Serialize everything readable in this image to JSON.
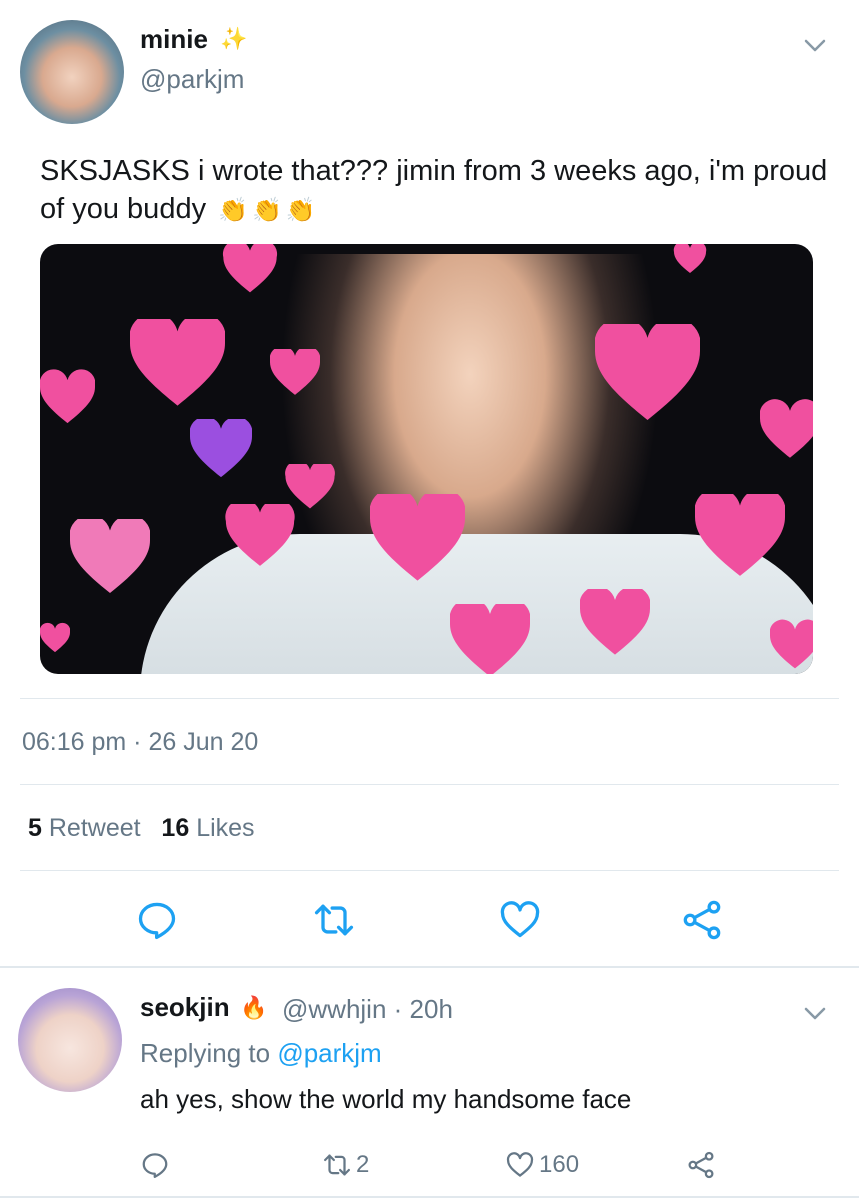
{
  "tweet": {
    "author_name": "minie",
    "author_badge": "✨",
    "author_handle": "@parkjm",
    "text": "SKSJASKS i wrote that??? jimin from 3 weeks ago, i'm proud of you buddy",
    "emojis": [
      "👏",
      "👏",
      "👏"
    ],
    "timestamp": "06:16 pm · 26 Jun 20",
    "retweet_count": "5",
    "retweet_label": "Retweet",
    "like_count": "16",
    "like_label": "Likes",
    "actions": [
      "reply-icon",
      "retweet-icon",
      "like-icon",
      "share-icon"
    ]
  },
  "reply": {
    "author_name": "seokjin",
    "author_badge": "🔥",
    "author_handle": "@wwhjin",
    "time": "· 20h",
    "replying_prefix": "Replying to",
    "replying_to": "@parkjm",
    "text": "ah yes, show the world my handsome face",
    "reply_count": "",
    "retweet_count": "2",
    "like_count": "160"
  },
  "colors": {
    "accent": "#1da1f2",
    "muted": "#657786",
    "text": "#14171a",
    "divider": "#e1e8ed",
    "heart_pink": "#f0509f",
    "heart_purple": "#9b4fe0"
  }
}
